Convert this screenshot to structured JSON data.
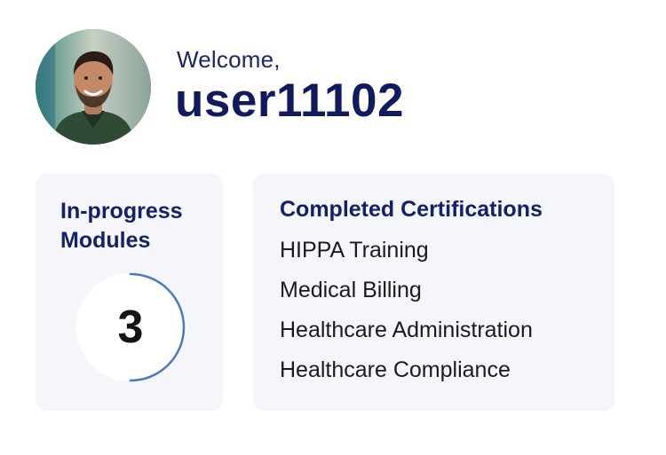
{
  "header": {
    "greeting": "Welcome,",
    "username": "user11102",
    "avatar_alt": "user avatar"
  },
  "in_progress": {
    "title": "In-progress Modules",
    "count": "3",
    "ring_fraction": 0.5,
    "ring_color": "#4a78c9"
  },
  "certifications": {
    "title": "Completed Certifications",
    "items": [
      "HIPPA Training",
      "Medical Billing",
      "Healthcare Administration",
      "Healthcare Compliance"
    ]
  },
  "colors": {
    "primary_text": "#111a5e",
    "card_bg": "#f4f6f9"
  }
}
